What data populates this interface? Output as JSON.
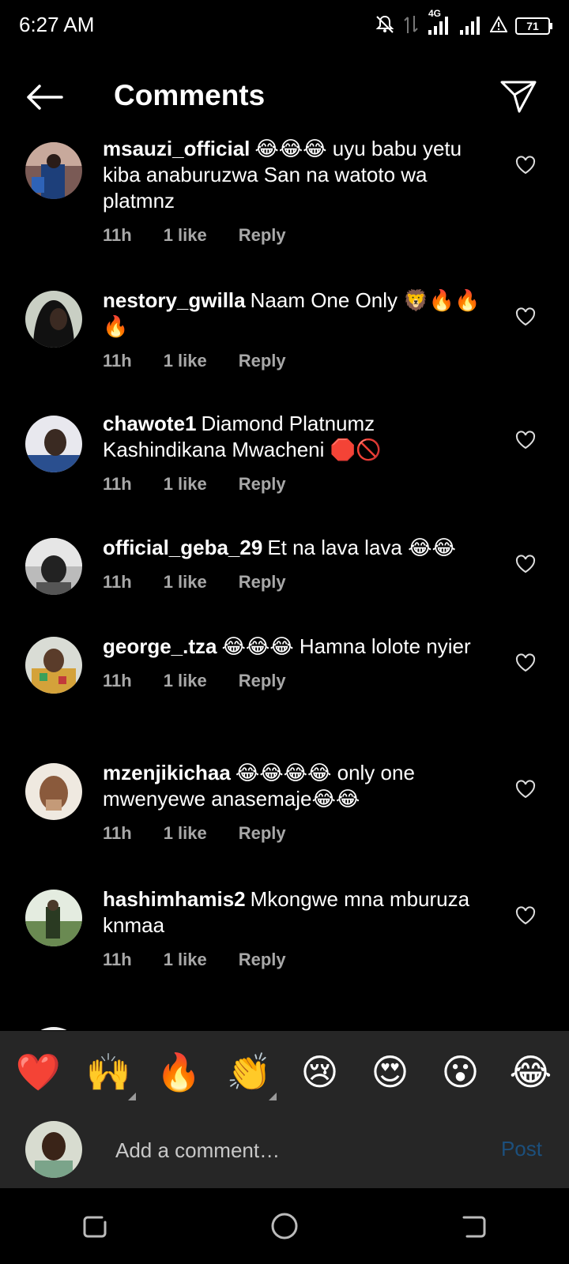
{
  "status_bar": {
    "time": "6:27 AM",
    "network": "4G",
    "battery": "71"
  },
  "header": {
    "title": "Comments"
  },
  "comments": [
    {
      "username": "msauzi_official",
      "text": "😂😂😂 uyu babu yetu kiba anaburuzwa San na watoto wa platmnz",
      "time": "11h",
      "likes": "1 like",
      "reply": "Reply"
    },
    {
      "username": "nestory_gwilla",
      "text": "Naam One Only 🦁🔥🔥🔥",
      "time": "11h",
      "likes": "1 like",
      "reply": "Reply"
    },
    {
      "username": "chawote1",
      "text": "Diamond Platnumz Kashindikana Mwacheni 🛑🚫",
      "time": "11h",
      "likes": "1 like",
      "reply": "Reply"
    },
    {
      "username": "official_geba_29",
      "text": "Et na lava lava 😂😂",
      "time": "11h",
      "likes": "1 like",
      "reply": "Reply"
    },
    {
      "username": "george_.tza",
      "text": "😂😂😂 Hamna lolote nyier",
      "time": "11h",
      "likes": "1 like",
      "reply": "Reply"
    },
    {
      "username": "mzenjikichaa",
      "text": "😂😂😂😂 only one mwenyewe anasemaje😂😂",
      "time": "11h",
      "likes": "1 like",
      "reply": "Reply"
    },
    {
      "username": "hashimhamis2",
      "text": "Mkongwe mna mburuza knmaa",
      "time": "11h",
      "likes": "1 like",
      "reply": "Reply"
    }
  ],
  "reactions": [
    "❤️",
    "🙌",
    "🔥",
    "👏",
    "😢",
    "😍",
    "😮",
    "😂"
  ],
  "composer": {
    "placeholder": "Add a comment…",
    "post_label": "Post"
  },
  "colors": {
    "background": "#000000",
    "panel": "#262626",
    "meta_text": "#a8a8a8",
    "post_disabled": "#1c4f7c"
  }
}
